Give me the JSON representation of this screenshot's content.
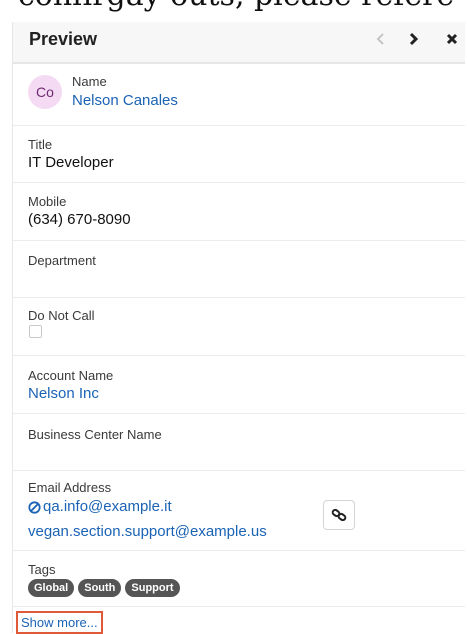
{
  "background_text": "confirgay outs, please refere",
  "header": {
    "title": "Preview",
    "prev_icon": "chevron-left-icon",
    "next_icon": "chevron-right-icon",
    "close_icon": "close-icon"
  },
  "avatar": {
    "initials": "Co",
    "bg_color": "#f4dbf3"
  },
  "fields": {
    "name": {
      "label": "Name",
      "value": "Nelson Canales"
    },
    "title": {
      "label": "Title",
      "value": "IT Developer"
    },
    "mobile": {
      "label": "Mobile",
      "value": "(634) 670-8090"
    },
    "department": {
      "label": "Department",
      "value": ""
    },
    "do_not_call": {
      "label": "Do Not Call",
      "checked": false
    },
    "account_name": {
      "label": "Account Name",
      "value": "Nelson Inc"
    },
    "business_center": {
      "label": "Business Center Name",
      "value": ""
    },
    "email": {
      "label": "Email Address",
      "primary": "qa.info@example.it",
      "secondary": "vegan.section.support@example.us",
      "opt_out_icon": "opt-out-icon",
      "link_icon": "link-icon"
    },
    "tags": {
      "label": "Tags",
      "items": [
        "Global",
        "South",
        "Support"
      ]
    }
  },
  "show_more": "Show more...",
  "colors": {
    "link": "#1a63b5",
    "tag_bg": "#555555",
    "highlight": "#e05a3a"
  }
}
